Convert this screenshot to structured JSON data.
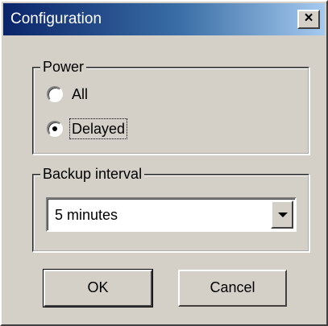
{
  "window": {
    "title": "Configuration",
    "close_glyph": "×",
    "close_icon": "close-icon"
  },
  "power": {
    "legend": "Power",
    "options": [
      {
        "label": "All",
        "checked": false
      },
      {
        "label": "Delayed",
        "checked": true
      }
    ]
  },
  "backup": {
    "legend": "Backup interval",
    "selected": "5 minutes",
    "dropdown_icon": "chevron-down-icon"
  },
  "buttons": {
    "ok_label": "OK",
    "cancel_label": "Cancel"
  },
  "colors": {
    "face": "#d4d0c8",
    "title_start": "#0a246a",
    "title_end": "#a6caf0"
  }
}
